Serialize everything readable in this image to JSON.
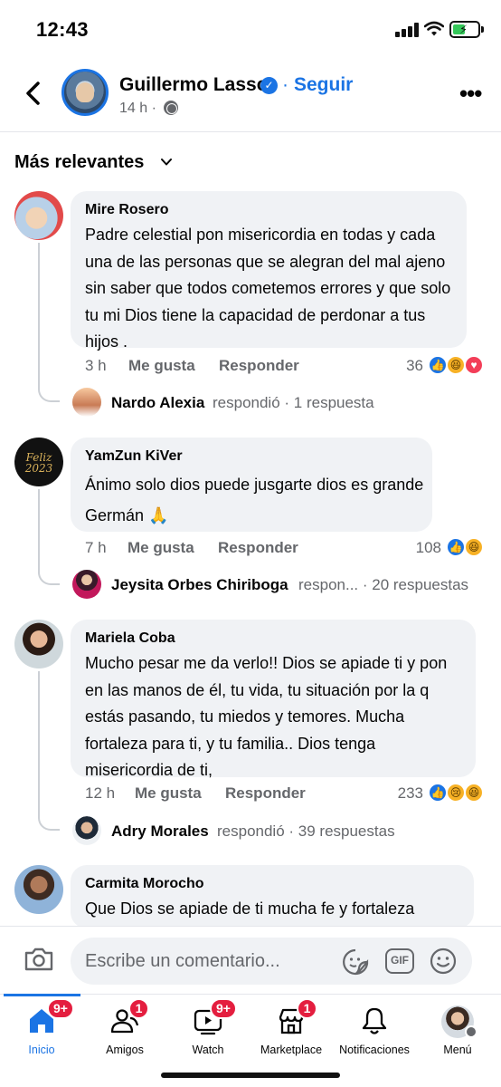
{
  "status_bar": {
    "time": "12:43"
  },
  "post_header": {
    "author": "Guillermo Lasso",
    "follow_separator": "·",
    "follow_label": "Seguir",
    "time": "14 h ·"
  },
  "sort": {
    "label": "Más relevantes"
  },
  "comments": [
    {
      "author": "Mire Rosero",
      "text": "Padre celestial pon  misericordia en todas y cada una de las personas que se alegran del mal ajeno sin saber que todos cometemos errores y que solo tu mi Dios tiene  la capacidad de perdonar a tus hijos .",
      "time": "3 h",
      "like_label": "Me gusta",
      "reply_label": "Responder",
      "reaction_count": "36",
      "reactions": [
        "like-icon",
        "haha-icon",
        "love-icon"
      ],
      "reply": {
        "name": "Nardo Alexia",
        "rest": "respondió · 1 respuesta"
      }
    },
    {
      "author": "YamZun KiVer",
      "text": "Ánimo  solo dios puede jusgarte  dios es grande  Germán 🙏",
      "time": "7 h",
      "like_label": "Me gusta",
      "reply_label": "Responder",
      "reaction_count": "108",
      "reactions": [
        "like-icon",
        "haha-icon"
      ],
      "reply": {
        "name": "Jeysita Orbes Chiriboga",
        "rest": "respon... · 20 respuestas"
      }
    },
    {
      "author": "Mariela Coba",
      "text": "Mucho pesar me da verlo!! Dios se apiade ti y pon en las manos de él, tu vida, tu situación por la q estás pasando, tu miedos y temores. Mucha fortaleza para ti, y tu familia.. Dios tenga misericordia de ti,",
      "time": "12 h",
      "like_label": "Me gusta",
      "reply_label": "Responder",
      "reaction_count": "233",
      "reactions": [
        "like-icon",
        "sad-icon",
        "haha-icon"
      ],
      "reply": {
        "name": "Adry Morales",
        "rest": "respondió · 39 respuestas"
      }
    },
    {
      "author": "Carmita Morocho",
      "text": "Que Dios se apiade de ti mucha fe y fortaleza"
    }
  ],
  "composer": {
    "placeholder": "Escribe un comentario...",
    "gif_label": "GIF"
  },
  "tabs": [
    {
      "label": "Inicio",
      "badge": "9+",
      "active": true
    },
    {
      "label": "Amigos",
      "badge": "1"
    },
    {
      "label": "Watch",
      "badge": "9+"
    },
    {
      "label": "Marketplace",
      "badge": "1"
    },
    {
      "label": "Notificaciones",
      "badge": ""
    },
    {
      "label": "Menú",
      "badge": ""
    }
  ],
  "colors": {
    "accent": "#1b74e4",
    "badge": "#e41e3f",
    "bubble": "#f0f2f5",
    "secondary_text": "#65676b"
  }
}
